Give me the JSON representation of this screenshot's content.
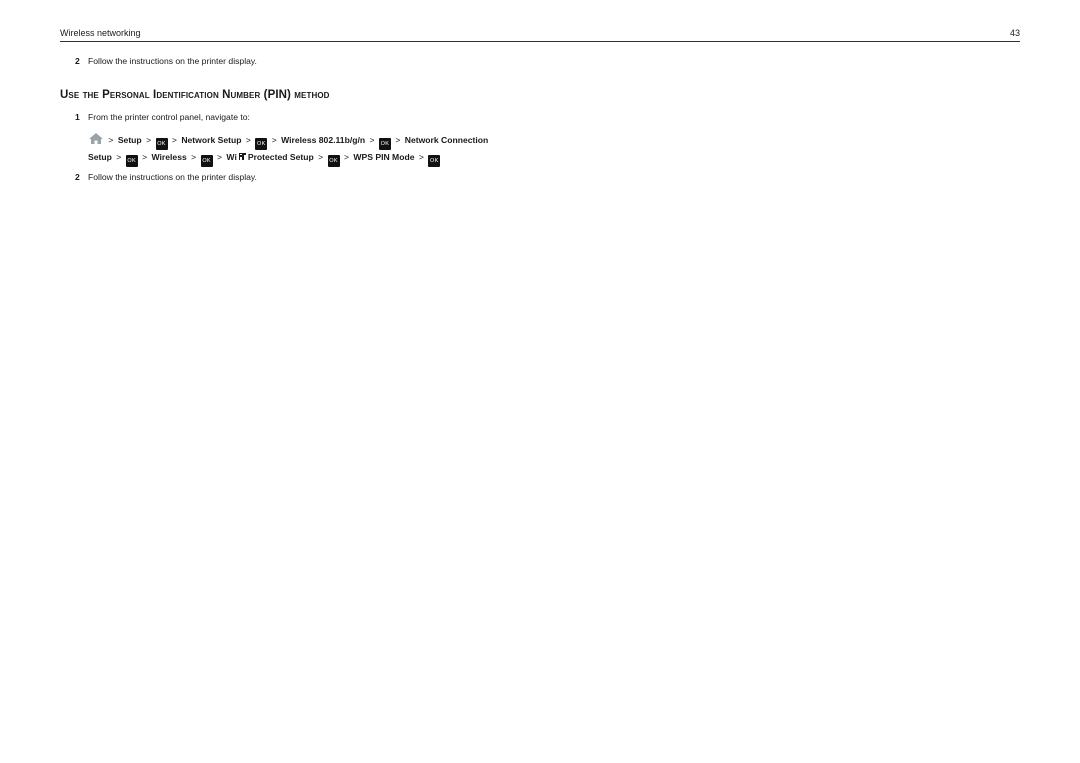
{
  "header": {
    "section_title": "Wireless networking",
    "page_number": "43"
  },
  "top_step": {
    "number": "2",
    "text": "Follow the instructions on the printer display."
  },
  "section": {
    "heading": "Use the Personal Identification Number (PIN) method",
    "steps": [
      {
        "number": "1",
        "text": "From the printer control panel, navigate to:"
      },
      {
        "number": "2",
        "text": "Follow the instructions on the printer display."
      }
    ],
    "navigation_path": {
      "separator": ">",
      "ok_label": "OK",
      "home_icon": "home-icon",
      "items": [
        "Setup",
        "Network Setup",
        "Wireless 802.11b/g/n",
        "Network Connection Setup",
        "Wireless",
        "Wi",
        "Protected Setup",
        "WPS PIN Mode"
      ],
      "line1": {
        "setup": "Setup",
        "network_setup": "Network Setup",
        "wireless_80211": "Wireless 802.11b/g/n",
        "network_connection": "Network Connection"
      },
      "line2": {
        "setup": "Setup",
        "wireless": "Wireless",
        "wi": "Wi",
        "protected_setup": "Protected Setup",
        "wps_pin_mode": "WPS PIN Mode"
      }
    }
  }
}
